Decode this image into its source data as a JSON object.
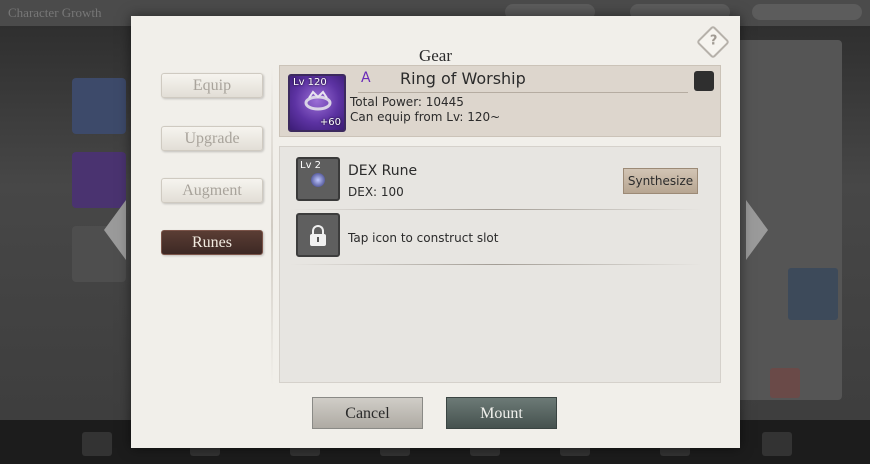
{
  "background": {
    "title": "Character Growth"
  },
  "modal": {
    "title": "Gear",
    "help_icon": "?"
  },
  "tabs": [
    {
      "label": "Equip",
      "active": false
    },
    {
      "label": "Upgrade",
      "active": false
    },
    {
      "label": "Augment",
      "active": false
    },
    {
      "label": "Runes",
      "active": true
    }
  ],
  "gear": {
    "level": "Lv 120",
    "grade": "A",
    "name": "Ring of Worship",
    "power": "Total Power: 10445",
    "requirement": "Can equip from Lv: 120~",
    "enhance": "+60",
    "icon": "ring-icon",
    "grade_color": "#6a2ab8"
  },
  "runes": {
    "slot1": {
      "level": "Lv 2",
      "name": "DEX Rune",
      "stat": "DEX: 100",
      "action": "Synthesize",
      "icon": "rune-gem-icon"
    },
    "slot2": {
      "hint": "Tap icon to construct slot",
      "icon": "lock-icon"
    }
  },
  "buttons": {
    "cancel": "Cancel",
    "mount": "Mount"
  }
}
